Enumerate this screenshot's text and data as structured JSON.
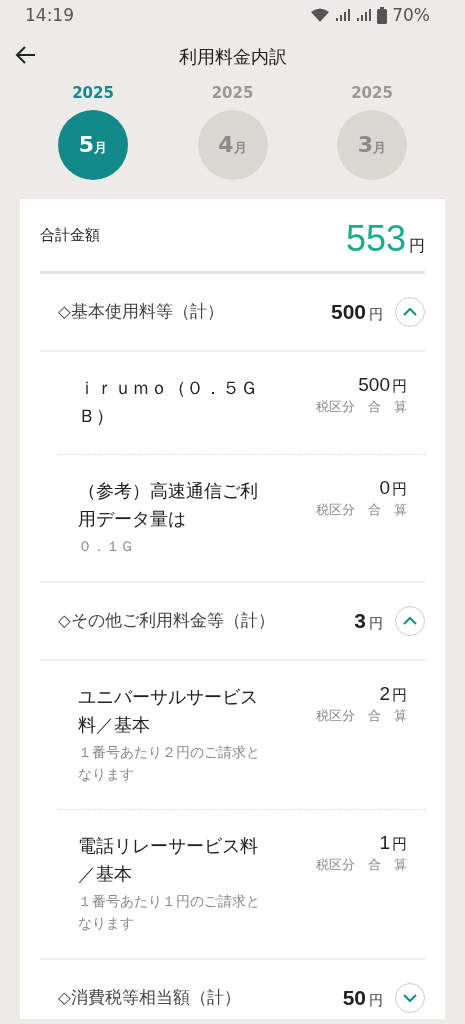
{
  "status_bar": {
    "time": "14:19",
    "battery": "70%"
  },
  "header": {
    "title": "利用料金内訳"
  },
  "months": [
    {
      "year": "2025",
      "month": "5",
      "unit": "月",
      "selected": true
    },
    {
      "year": "2025",
      "month": "4",
      "unit": "月",
      "selected": false
    },
    {
      "year": "2025",
      "month": "3",
      "unit": "月",
      "selected": false
    }
  ],
  "total": {
    "label": "合計金額",
    "amount": "553",
    "unit": "円"
  },
  "sections": [
    {
      "title": "◇基本使用料等（計）",
      "amount": "500",
      "unit": "円",
      "expanded": true,
      "items": [
        {
          "name": "ｉｒｕｍｏ（０．５ＧＢ）",
          "amount": "500",
          "unit": "円",
          "tax": "税区分　合　算"
        },
        {
          "name": "（参考）高速通信ご利用データ量は",
          "note": "０．１Ｇ",
          "amount": "0",
          "unit": "円",
          "tax": "税区分　合　算"
        }
      ]
    },
    {
      "title": "◇その他ご利用料金等（計）",
      "amount": "3",
      "unit": "円",
      "expanded": true,
      "items": [
        {
          "name": "ユニバーサルサービス料／基本",
          "amount": "2",
          "unit": "円",
          "tax": "税区分　合　算",
          "note": "１番号あたり２円のご請求となります"
        },
        {
          "name": "電話リレーサービス料／基本",
          "amount": "1",
          "unit": "円",
          "tax": "税区分　合　算",
          "note": "１番号あたり１円のご請求となります"
        }
      ]
    },
    {
      "title": "◇消費税等相当額（計）",
      "amount": "50",
      "unit": "円",
      "expanded": false
    }
  ]
}
